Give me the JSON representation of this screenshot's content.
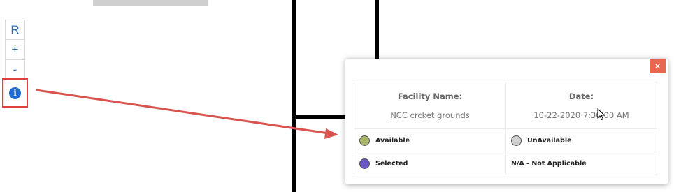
{
  "zoom_controls": {
    "reset_label": "R",
    "zoom_in_label": "+",
    "zoom_out_label": "-",
    "info_icon": "info-icon"
  },
  "modal": {
    "close_label": "×",
    "facility_label": "Facility Name:",
    "facility_value": "NCC crcket grounds",
    "date_label": "Date:",
    "date_value": "10-22-2020 7:30:00 AM",
    "legend": [
      {
        "label": "Available",
        "color": "#a8b46a"
      },
      {
        "label": "UnAvailable",
        "color": "#cfcfcf"
      },
      {
        "label": "Selected",
        "color": "#6a56c4"
      },
      {
        "label": "N/A - Not Applicable"
      }
    ]
  },
  "colors": {
    "accent_red": "#e0413c",
    "close_button": "#e8674f",
    "link_blue": "#2d6fb8"
  }
}
